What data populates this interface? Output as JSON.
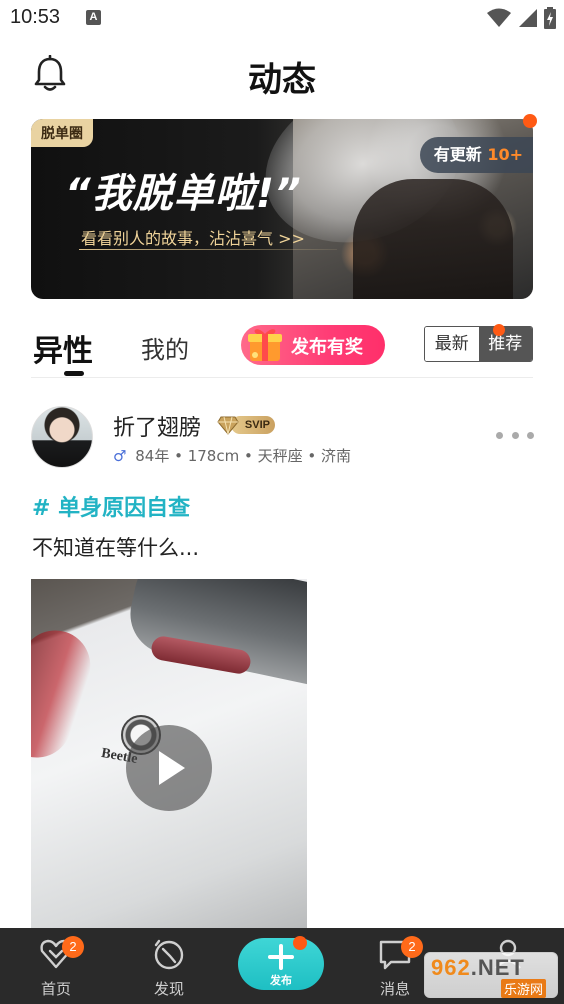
{
  "status_bar": {
    "time": "10:53",
    "notification_badge": "A"
  },
  "header": {
    "title": "动态"
  },
  "banner": {
    "tag": "脱单圈",
    "headline": "“我脱单啦!”",
    "subline": "看看别人的故事，沾沾喜气 >>",
    "updates_label": "有更新",
    "updates_count": "10+"
  },
  "tabs": {
    "hetero": "异性",
    "mine": "我的",
    "publish_reward": "发布有奖",
    "sort_newest": "最新",
    "sort_recommend": "推荐"
  },
  "post": {
    "username": "折了翅膀",
    "vip_badge": "SVIP",
    "gender_symbol": "♂",
    "meta": "84年 • 178cm • 天秤座 • 济南",
    "topic": "# 单身原因自查",
    "text": "不知道在等什么...",
    "video_brand": "Beetle"
  },
  "bottom_nav": {
    "home": {
      "label": "首页",
      "badge": "2"
    },
    "discover": {
      "label": "发现"
    },
    "publish": {
      "label": "发布"
    },
    "messages": {
      "label": "消息",
      "badge": "2"
    },
    "profile": {
      "label": ""
    }
  },
  "watermark": {
    "brand": "962",
    "brand_suffix": ".NET",
    "site_name": "乐游网"
  },
  "colors": {
    "accent_teal": "#22b3c4",
    "badge_orange": "#ff6a1a",
    "nav_bg": "#2a2a2a",
    "reward_pink": "#ff3d76"
  },
  "icons": [
    "bell-icon",
    "wifi-icon",
    "signal-icon",
    "battery-icon",
    "gift-icon",
    "diamond-icon",
    "play-icon",
    "more-icon",
    "heart-icon",
    "compass-icon",
    "plus-icon",
    "chat-icon",
    "person-icon"
  ]
}
